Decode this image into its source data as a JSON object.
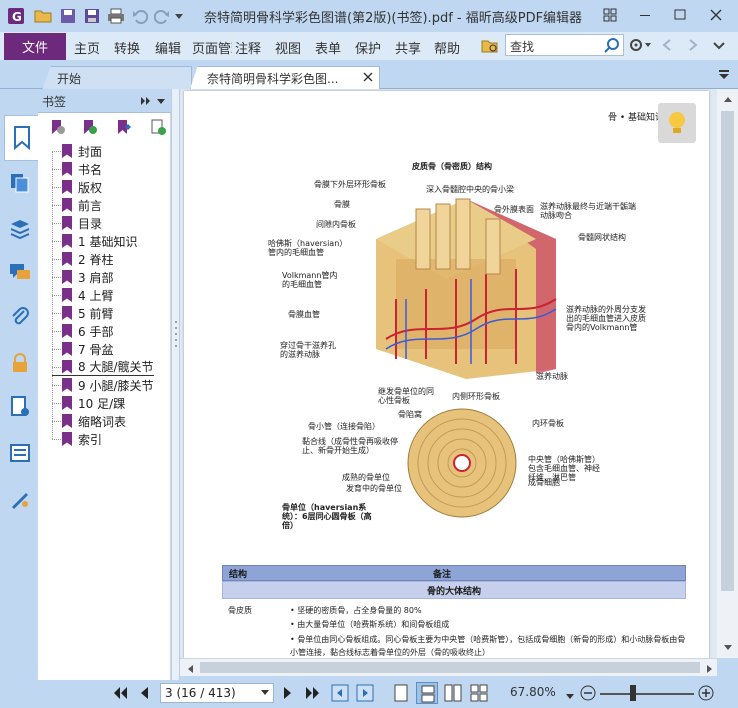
{
  "window": {
    "title": "奈特简明骨科学彩色图谱(第2版)(书签).pdf - 福昕高级PDF编辑器"
  },
  "menu": {
    "file": "文件",
    "items": [
      "主页",
      "转换",
      "编辑",
      "页面管理",
      "注释",
      "视图",
      "表单",
      "保护",
      "共享",
      "帮助"
    ]
  },
  "search": {
    "placeholder": "查找"
  },
  "tabs": [
    {
      "label": "开始"
    },
    {
      "label": "奈特简明骨科学彩色图..."
    }
  ],
  "bookmarks": {
    "title": "书签",
    "items": [
      "封面",
      "书名",
      "版权",
      "前言",
      "目录",
      "1 基础知识",
      "2 脊柱",
      "3 肩部",
      "4 上臂",
      "5 前臂",
      "6 手部",
      "7 骨盆",
      "8 大腿/髋关节",
      "9 小腿/膝关节",
      "10 足/踝",
      "缩略词表",
      "索引"
    ]
  },
  "page_content": {
    "header_right": "骨 • 基础知识",
    "figure_title": "皮质骨（骨密质）结构",
    "labels": [
      "骨膜下外层环形骨板",
      "骨膜",
      "间隙内骨板",
      "哈佛斯（haversian）管内的毛细血管",
      "Volkmann管内的毛细血管",
      "骨膜血管",
      "穿过骨干滋养孔的滋养动脉",
      "深入骨髓腔中央的骨小梁",
      "骨外膜表面",
      "滋养动脉最终与近端干骺端动脉吻合",
      "骨髓网状结构",
      "滋养动脉的外周分支发出的毛细血管进入皮质骨内的Volkmann管",
      "滋养动脉",
      "继发骨单位的同心性骨板",
      "内侧环形骨板",
      "骨陷窝",
      "骨小管（连接骨陷）",
      "黏合线（成骨性骨再吸收停止、新骨开始生成）",
      "内环骨板",
      "中央管（哈佛斯管）包含毛细血管、神经纤维、淋巴管",
      "成骨细胞",
      "成熟的骨单位",
      "发育中的骨单位"
    ],
    "caption": "骨单位（haversian系统）：6层同心圆骨板（高倍）",
    "table": {
      "col1": "结构",
      "col2": "备注",
      "subheader": "骨的大体结构",
      "row_label": "骨皮质",
      "bullets": [
        "坚硬的密质骨，占全身骨量的 80%",
        "由大量骨单位（哈费斯系统）和间骨板组成",
        "骨单位由同心骨板组成。同心骨板主要为中央管（哈费斯管），包括成骨细胞（新骨的形成）和小动脉骨板由骨小管连接，黏合线标志着骨单位的外层（骨的吸收终止）"
      ]
    }
  },
  "status": {
    "page_field": "3 (16 / 413)",
    "zoom": "67.80%"
  },
  "colors": {
    "accent": "#6d2a7d",
    "chrome": "#bfd7f1",
    "bookmark_flag": "#7a2f8a"
  }
}
